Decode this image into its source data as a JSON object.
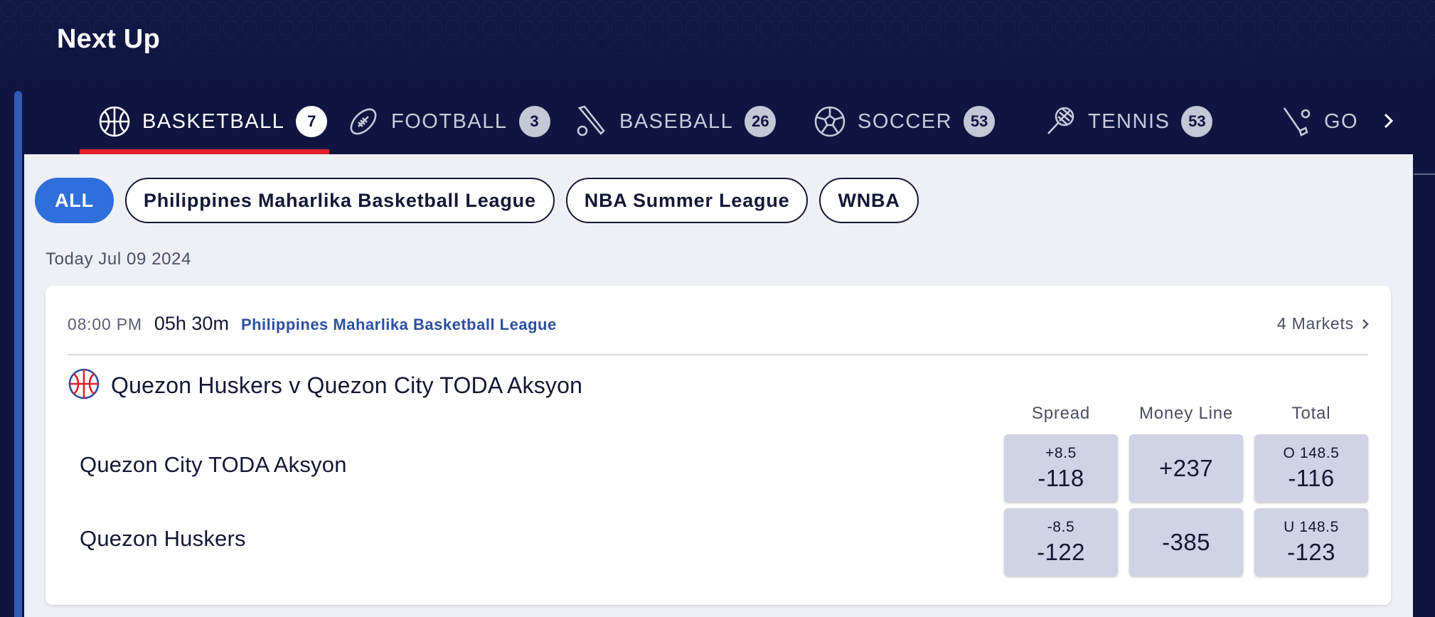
{
  "header": {
    "title": "Next Up"
  },
  "tabs": [
    {
      "label": "BASKETBALL",
      "count": "7",
      "icon": "basketball-icon",
      "active": true
    },
    {
      "label": "FOOTBALL",
      "count": "3",
      "icon": "football-icon"
    },
    {
      "label": "BASEBALL",
      "count": "26",
      "icon": "baseball-bat-icon"
    },
    {
      "label": "SOCCER",
      "count": "53",
      "icon": "soccer-ball-icon"
    },
    {
      "label": "TENNIS",
      "count": "53",
      "icon": "tennis-racket-icon"
    },
    {
      "label": "GO",
      "icon": "golf-icon"
    }
  ],
  "filters": [
    {
      "label": "ALL",
      "active": true
    },
    {
      "label": "Philippines Maharlika Basketball League"
    },
    {
      "label": "NBA Summer League"
    },
    {
      "label": "WNBA"
    }
  ],
  "date_label": "Today Jul 09 2024",
  "event": {
    "time": "08:00 PM",
    "countdown": "05h 30m",
    "league": "Philippines Maharlika Basketball League",
    "markets": "4 Markets",
    "title": "Quezon Huskers v Quezon City TODA Aksyon",
    "columns": [
      "Spread",
      "Money Line",
      "Total"
    ],
    "teams": [
      {
        "name": "Quezon City TODA Aksyon",
        "spread": {
          "line": "+8.5",
          "price": "-118"
        },
        "moneyline": {
          "price": "+237"
        },
        "total": {
          "line": "O 148.5",
          "price": "-116"
        }
      },
      {
        "name": "Quezon Huskers",
        "spread": {
          "line": "-8.5",
          "price": "-122"
        },
        "moneyline": {
          "price": "-385"
        },
        "total": {
          "line": "U 148.5",
          "price": "-123"
        }
      }
    ]
  },
  "colors": {
    "header_bg": "#0f1540",
    "active_underline": "#e2202a",
    "chip_active": "#2f6fdc",
    "odds_button": "#ced3e6",
    "league_link": "#2d4fa4"
  }
}
